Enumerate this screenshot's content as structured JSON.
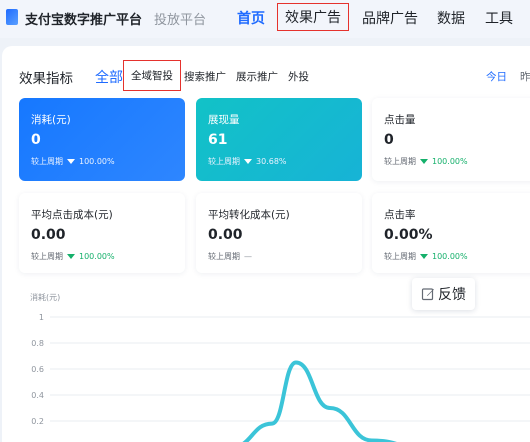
{
  "header": {
    "brand": "支付宝数字推广平台",
    "brand_sub": "投放平台",
    "nav": [
      {
        "label": "首页",
        "state": "active"
      },
      {
        "label": "效果广告",
        "state": "highlighted"
      },
      {
        "label": "品牌广告"
      },
      {
        "label": "数据"
      },
      {
        "label": "工具"
      }
    ]
  },
  "section": {
    "title": "效果指标",
    "tabs": [
      "全部",
      "全域智投",
      "搜索推广",
      "展示推广",
      "外投"
    ],
    "highlighted_tab": "全域智投",
    "date_options": [
      "今日",
      "昨"
    ]
  },
  "cards": [
    {
      "label": "消耗(元)",
      "value": "0",
      "compare_label": "较上周期",
      "trend": "down",
      "change": "100.00%",
      "style": "blue"
    },
    {
      "label": "展现量",
      "value": "61",
      "compare_label": "较上周期",
      "trend": "down",
      "change": "30.68%",
      "style": "teal"
    },
    {
      "label": "点击量",
      "value": "0",
      "compare_label": "较上周期",
      "trend": "down",
      "change": "100.00%",
      "style": "white"
    },
    {
      "label": "平均点击成本(元)",
      "value": "0.00",
      "compare_label": "较上周期",
      "trend": "down",
      "change": "100.00%",
      "style": "white"
    },
    {
      "label": "平均转化成本(元)",
      "value": "0.00",
      "compare_label": "较上周期",
      "trend": "none",
      "change": "—",
      "style": "white"
    },
    {
      "label": "点击率",
      "value": "0.00%",
      "compare_label": "较上周期",
      "trend": "down",
      "change": "100.00%",
      "style": "white"
    }
  ],
  "feedback": {
    "label": "反馈",
    "icon": "edit-icon"
  },
  "colors": {
    "accent": "#1f6bff",
    "highlight_box": "#e5322d",
    "card_blue": "#1678ff",
    "card_teal": "#12c2c7",
    "trend_green": "#15b06b",
    "line": "#3bc4d8"
  },
  "chart_data": {
    "type": "line",
    "ylabel": "消耗(元)",
    "yticks": [
      "1",
      "0.8",
      "0.6",
      "0.4",
      "0.2"
    ],
    "ylim": [
      0,
      1
    ],
    "grid": true,
    "series": [
      {
        "values": [
          0.02,
          0.0,
          0.18,
          0.65,
          0.3,
          0.05,
          0.0
        ]
      }
    ]
  }
}
